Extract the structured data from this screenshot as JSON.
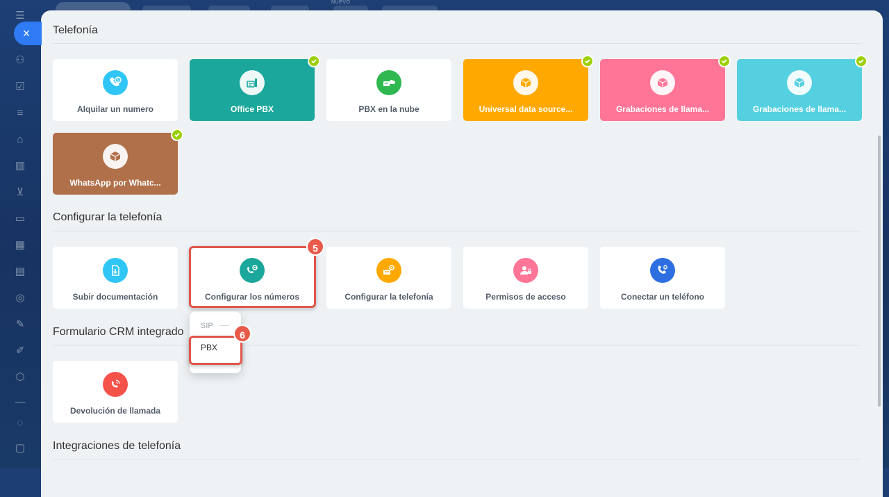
{
  "topbar": {
    "nuevo": "NUEVO"
  },
  "sidebar": {
    "icons": [
      "menu-icon",
      "users-icon",
      "tasks-icon",
      "filter-icon",
      "robot-icon",
      "chart-icon",
      "cart-icon",
      "contacts-icon",
      "calendar-icon",
      "building-icon",
      "target-icon",
      "edit-icon",
      "pencil-icon",
      "box-icon",
      "divider-icon",
      "settings-icon",
      "more-icon"
    ]
  },
  "close_button": {
    "label": "×"
  },
  "sections": [
    {
      "title": "Telefonía"
    },
    {
      "title": "Configurar la telefonía"
    },
    {
      "title": "Formulario CRM integrado"
    },
    {
      "title": "Integraciones de telefonía"
    }
  ],
  "telefonia_tiles": [
    {
      "label": "Alquilar un numero",
      "icon": "phone-dollar-icon",
      "bg": "#ffffff",
      "icon_bg": "#2fc6f6",
      "checked": false
    },
    {
      "label": "Office PBX",
      "icon": "pbx-icon",
      "bg": "#1ba79c",
      "icon_bg": "#ffffff",
      "checked": true
    },
    {
      "label": "PBX en la nube",
      "icon": "cloud-pbx-icon",
      "bg": "#ffffff",
      "icon_bg": "#2eb84f",
      "checked": false
    },
    {
      "label": "Universal data source...",
      "icon": "box-icon",
      "bg": "#ffa900",
      "icon_bg": "#ffffff",
      "checked": true
    },
    {
      "label": "Grabaciones de llama...",
      "icon": "box-icon",
      "bg": "#ff7597",
      "icon_bg": "#ffffff",
      "checked": true
    },
    {
      "label": "Grabaciones de llama...",
      "icon": "box-icon",
      "bg": "#55d0e0",
      "icon_bg": "#ffffff",
      "checked": true
    },
    {
      "label": "WhatsApp por Whatc...",
      "icon": "box-icon",
      "bg": "#b0704a",
      "icon_bg": "#ffffff",
      "checked": true
    }
  ],
  "config_tiles": [
    {
      "label": "Subir documentación",
      "icon": "upload-doc-icon",
      "icon_bg": "#2fc6f6"
    },
    {
      "label": "Configurar los números",
      "icon": "phone-gear-icon",
      "icon_bg": "#1ba79c"
    },
    {
      "label": "Configurar la telefonía",
      "icon": "pbx-gear-icon",
      "icon_bg": "#ffa900"
    },
    {
      "label": "Permisos de acceso",
      "icon": "user-lock-icon",
      "icon_bg": "#ff7597"
    },
    {
      "label": "Conectar un teléfono",
      "icon": "phone-plug-icon",
      "icon_bg": "#2d6fe0"
    }
  ],
  "crm_tiles": [
    {
      "label": "Devolución de llamada",
      "icon": "callback-icon",
      "icon_bg": "#f5524a"
    }
  ],
  "popup": {
    "item_sip": "SIP",
    "item_pbx": "PBX"
  },
  "badges": {
    "step5": "5",
    "step6": "6"
  }
}
